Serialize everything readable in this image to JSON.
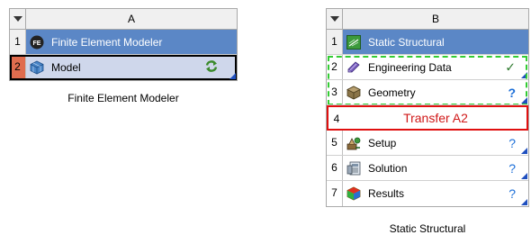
{
  "system_a": {
    "column_header": "A",
    "title": "Finite Element Modeler",
    "rows": [
      {
        "num": "1",
        "label": "Finite Element Modeler",
        "icon": "fe-icon"
      },
      {
        "num": "2",
        "label": "Model",
        "icon": "model-icon",
        "status_icon": "refresh-icon"
      }
    ]
  },
  "system_b": {
    "column_header": "B",
    "title": "Static Structural",
    "rows": [
      {
        "num": "1",
        "label": "Static Structural",
        "icon": "static-structural-icon"
      },
      {
        "num": "2",
        "label": "Engineering Data",
        "icon": "engineering-data-icon",
        "status_icon": "checkmark-icon",
        "status": "✓"
      },
      {
        "num": "3",
        "label": "Geometry",
        "icon": "geometry-icon",
        "status_icon": "question-icon",
        "status": "?"
      },
      {
        "num": "4",
        "label": "Transfer A2"
      },
      {
        "num": "5",
        "label": "Setup",
        "icon": "setup-icon",
        "status_icon": "question-icon",
        "status": "?"
      },
      {
        "num": "6",
        "label": "Solution",
        "icon": "solution-icon",
        "status_icon": "question-icon",
        "status": "?"
      },
      {
        "num": "7",
        "label": "Results",
        "icon": "results-icon",
        "status_icon": "question-icon",
        "status": "?"
      }
    ]
  },
  "colors": {
    "title_row_bg": "#5b87c6",
    "selected_row_bg": "#cfd7eb",
    "selected_num_bg": "#e06c4e",
    "transfer_red": "#e01010",
    "dash_green": "#33cc33",
    "status_blue": "#1c6fd8"
  }
}
